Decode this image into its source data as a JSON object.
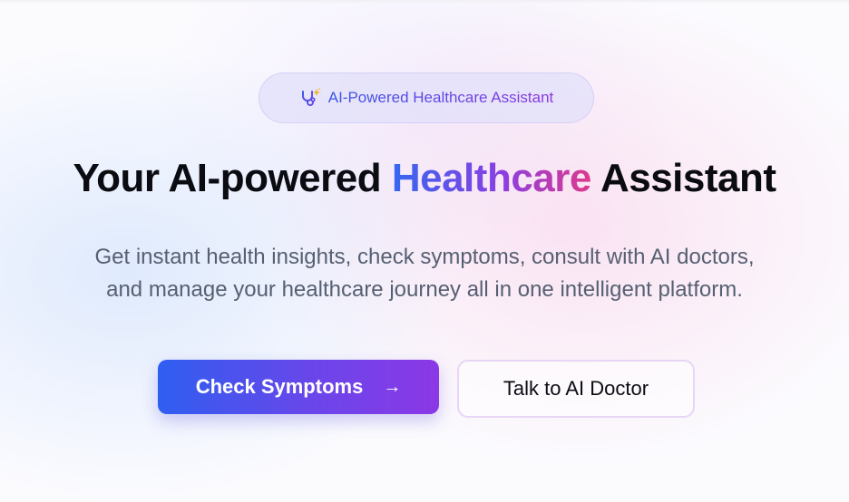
{
  "badge": {
    "icon": "stethoscope-sparkle-icon",
    "label": "AI-Powered Healthcare Assistant"
  },
  "hero": {
    "title_pre": "Your AI-powered ",
    "title_accent": "Healthcare",
    "title_post": " Assistant",
    "subtitle_line1": "Get instant health insights, check symptoms, consult with AI doctors,",
    "subtitle_line2": "and manage your healthcare journey all in one intelligent platform."
  },
  "actions": {
    "primary_label": "Check Symptoms",
    "primary_icon": "arrow-right-icon",
    "secondary_label": "Talk to AI Doctor"
  },
  "colors": {
    "accent_blue": "#3567f0",
    "accent_purple": "#8a3fe2",
    "accent_pink": "#de3a8c",
    "sparkle_gold": "#f2b01e"
  }
}
